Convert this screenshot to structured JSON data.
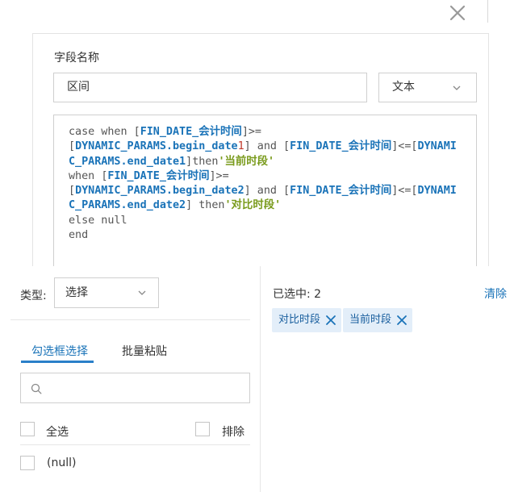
{
  "dialog": {
    "field_name_label": "字段名称",
    "field_name_value": "区间",
    "type_value": "文本",
    "expression_lines": [
      [
        {
          "t": "kw",
          "v": "case when "
        },
        {
          "t": "br",
          "v": "["
        },
        {
          "t": "fld",
          "v": "FIN_DATE_会计时间"
        },
        {
          "t": "br",
          "v": "]>="
        },
        {
          "t": "br",
          "v": "\n["
        },
        {
          "t": "fld",
          "v": "DYNAMIC_PARAMS.begin_date"
        },
        {
          "t": "num",
          "v": "1"
        },
        {
          "t": "br",
          "v": "]"
        },
        {
          "t": "kw",
          "v": " and "
        },
        {
          "t": "br",
          "v": "["
        },
        {
          "t": "fld",
          "v": "FIN_DATE_会计时间"
        },
        {
          "t": "br",
          "v": "]<=["
        },
        {
          "t": "fld",
          "v": "DYNAMIC_PARAMS.end_date1"
        },
        {
          "t": "br",
          "v": "]"
        },
        {
          "t": "kw",
          "v": "then"
        },
        {
          "t": "str",
          "v": "'当前时段'"
        }
      ],
      [
        {
          "t": "kw",
          "v": "\nwhen "
        },
        {
          "t": "br",
          "v": "["
        },
        {
          "t": "fld",
          "v": "FIN_DATE_会计时间"
        },
        {
          "t": "br",
          "v": "]>="
        },
        {
          "t": "br",
          "v": "\n["
        },
        {
          "t": "fld",
          "v": "DYNAMIC_PARAMS.begin_date2"
        },
        {
          "t": "br",
          "v": "]"
        },
        {
          "t": "kw",
          "v": " and "
        },
        {
          "t": "br",
          "v": "["
        },
        {
          "t": "fld",
          "v": "FIN_DATE_会计时间"
        },
        {
          "t": "br",
          "v": "]<=["
        },
        {
          "t": "fld",
          "v": "DYNAMIC_PARAMS.end_date2"
        },
        {
          "t": "br",
          "v": "]"
        },
        {
          "t": "kw",
          "v": " then"
        },
        {
          "t": "str",
          "v": "'对比时段'"
        }
      ],
      [
        {
          "t": "kw",
          "v": "\nelse null\nend"
        }
      ]
    ]
  },
  "filter": {
    "type_label": "类型:",
    "mode_value": "选择",
    "tabs": [
      "勾选框选择",
      "批量粘贴"
    ],
    "search_placeholder": "",
    "select_all_label": "全选",
    "exclude_label": "排除",
    "options": [
      "(null)"
    ],
    "selected_count_text": "已选中: 2",
    "clear_label": "清除",
    "selected_tags": [
      "对比时段",
      "当前时段"
    ]
  },
  "colors": {
    "accent": "#1a73b8",
    "tag_bg": "#e3eef9",
    "field_token": "#1a73b8",
    "string_token": "#7a9b1d"
  },
  "icons": [
    "close-icon",
    "chevron-down-icon",
    "search-icon",
    "tag-remove-icon"
  ]
}
